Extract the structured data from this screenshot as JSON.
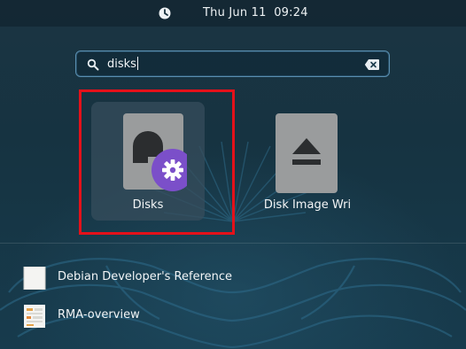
{
  "topbar": {
    "clock": "Thu Jun 11  09:24",
    "status_icon": "clock-icon"
  },
  "search": {
    "value": "disks",
    "search_icon": "search-icon",
    "clear_icon": "backspace-clear-icon"
  },
  "apps": [
    {
      "label": "Disks",
      "icon": "disks-app-icon",
      "selected": true
    },
    {
      "label": "Disk Image Wri",
      "icon": "eject-drive-icon",
      "selected": false
    }
  ],
  "results": [
    {
      "label": "Debian Developer's Reference",
      "icon": "document-icon"
    },
    {
      "label": "RMA-overview",
      "icon": "document-icon"
    }
  ],
  "colors": {
    "highlight": "#e4111a",
    "accent_badge": "#7b4fc9",
    "background": "#17303d"
  }
}
